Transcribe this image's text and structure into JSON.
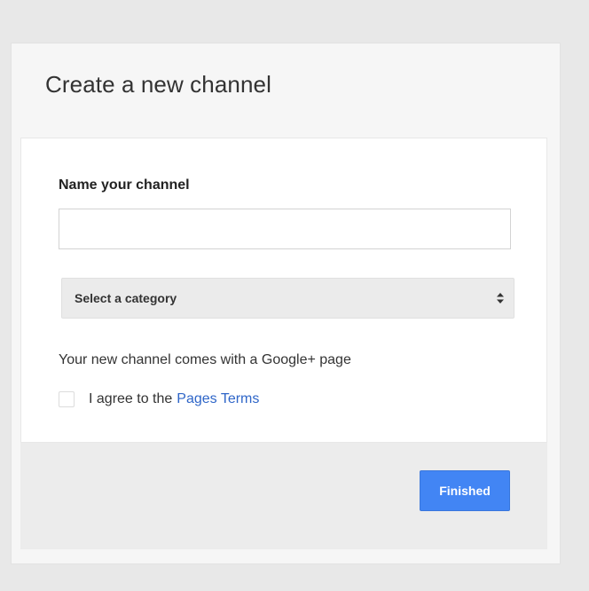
{
  "dialog": {
    "title": "Create a new channel"
  },
  "form": {
    "name_label": "Name your channel",
    "name_value": "",
    "category_label": "Select a category",
    "gplus_note": "Your new channel comes with a Google+ page",
    "agree_text": "I agree to the",
    "terms_link": "Pages Terms",
    "agree_checked": false
  },
  "footer": {
    "finished_label": "Finished"
  },
  "colors": {
    "accent": "#4285f4",
    "link": "#2f66c8"
  },
  "icons": {
    "category_select": "updown-arrows-icon"
  }
}
